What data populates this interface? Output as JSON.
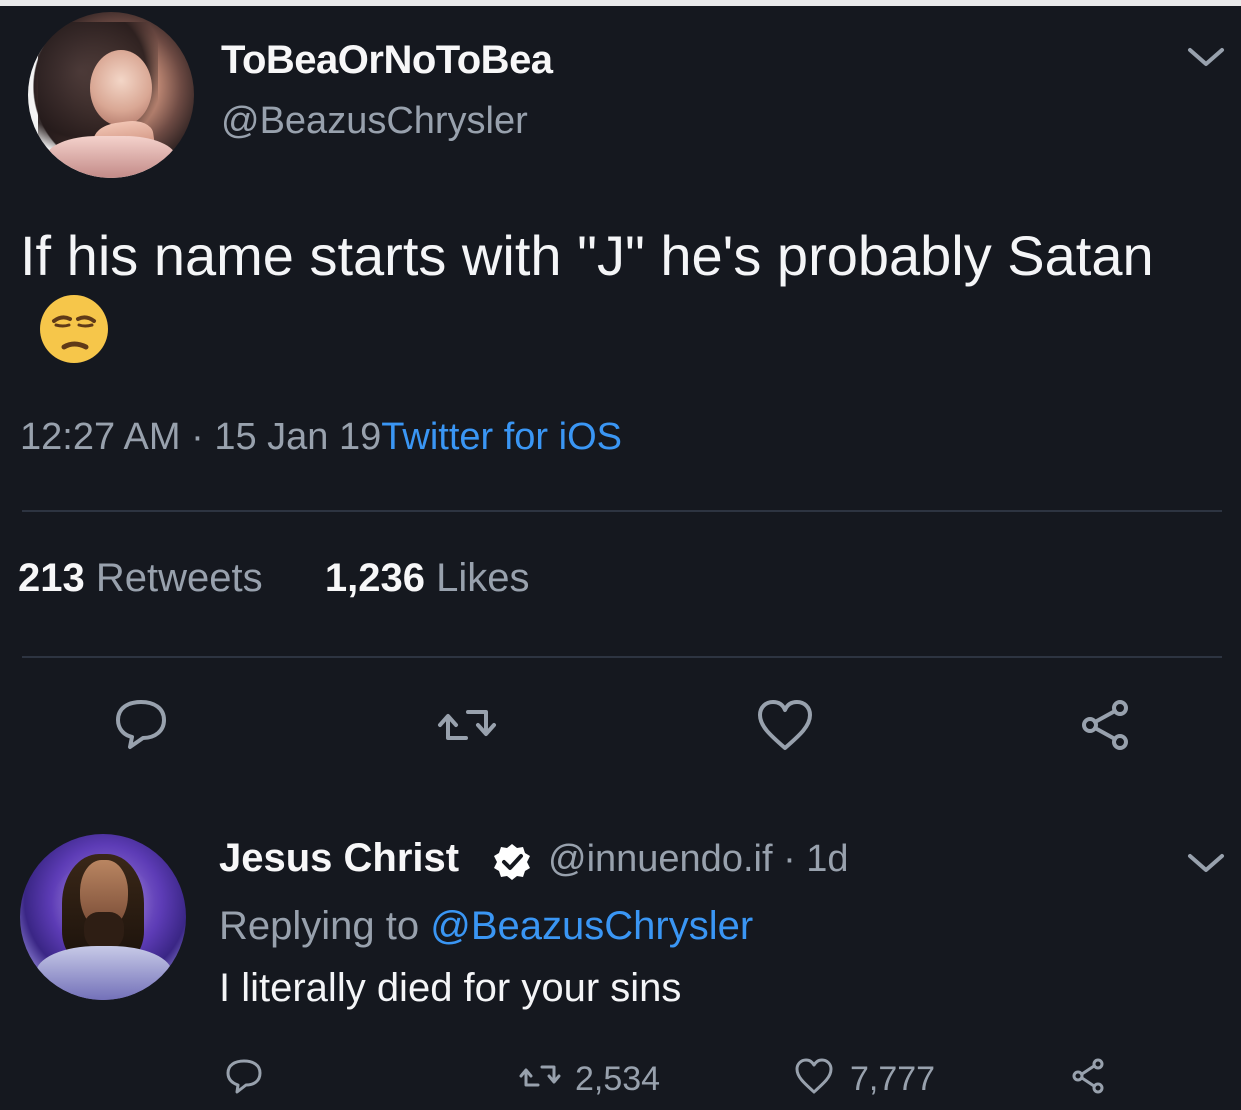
{
  "tweet": {
    "display_name": "ToBeaOrNoToBea",
    "handle": "@BeazusChrysler",
    "text": "If his name starts with \"J\" he's probably Satan",
    "emoji": "unamused-face",
    "time": "12:27 AM",
    "separator": "·",
    "date": "15 Jan 19",
    "source": "Twitter for iOS",
    "retweets_count": "213",
    "retweets_label": "Retweets",
    "likes_count": "1,236",
    "likes_label": "Likes",
    "actions": [
      {
        "name": "reply",
        "icon": "speech-bubble-icon"
      },
      {
        "name": "retweet",
        "icon": "retweet-icon"
      },
      {
        "name": "like",
        "icon": "heart-icon"
      },
      {
        "name": "share",
        "icon": "share-icon"
      }
    ]
  },
  "reply": {
    "display_name": "Jesus Christ",
    "verified": true,
    "handle_time": "@innuendo.if · 1d",
    "replying_prefix": "Replying to ",
    "replying_to": "@BeazusChrysler",
    "text": "I literally died for your sins",
    "retweets_count": "2,534",
    "likes_count": "7,777",
    "actions": [
      {
        "name": "reply",
        "icon": "speech-bubble-icon"
      },
      {
        "name": "retweet",
        "icon": "retweet-icon"
      },
      {
        "name": "like",
        "icon": "heart-icon"
      },
      {
        "name": "share",
        "icon": "share-icon"
      }
    ]
  },
  "colors": {
    "background": "#15181f",
    "text": "#f4f5f7",
    "muted": "#98a1ad",
    "link": "#3a96f4",
    "verified_badge": "#ffffff"
  }
}
